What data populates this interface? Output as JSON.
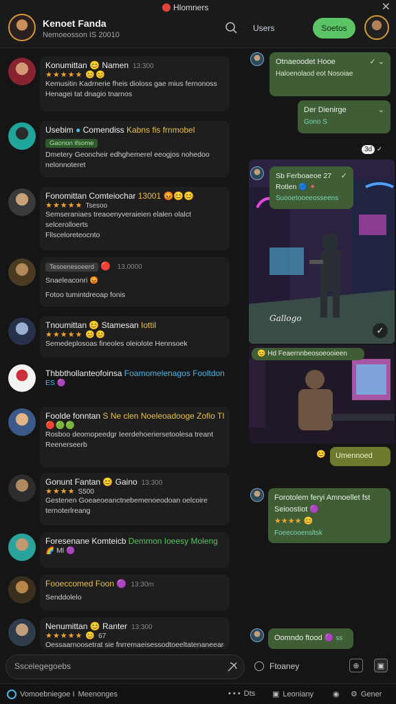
{
  "header": {
    "app_title": "Hlomners",
    "user_name": "Kenoet Fanda",
    "user_subtitle": "Nemoeosson IS 20010",
    "users_link": "Users",
    "green_button": "Soetos"
  },
  "conversations": [
    {
      "name": "Konumittan",
      "name_extra": "Namen",
      "time": "13:300",
      "stars": "★★★★★",
      "line1": "Kemusitin Kadrnerie fheis dioloss gae mius fernonoss",
      "line2": "Henagei tat dnagio tnarnos"
    },
    {
      "name": "Usebim",
      "name_extra": "Comendiss",
      "name_hl": "Kabns fis frnmobel",
      "tag": "Gaonon ifsome",
      "line1": "Dmetery Geoncheir edhghemerel eeogjos nohedoo",
      "line2": "nelonnoteret"
    },
    {
      "name": "Fonomittan",
      "name_extra": "Comteiochar",
      "time": "13001",
      "stars": "★★★★★",
      "stars_text": "Tsesoo",
      "line1": "Semseraniaes treaoenyveraieien elalen olalct",
      "line2": "selcerolloerts",
      "line3": "Fllsceloreteocnto"
    },
    {
      "name_pill": "Tesoenesoeerd",
      "time": "13,0000",
      "line1": "Snaeleaconri",
      "line2": "Fotoo tumintdreoap fonis"
    },
    {
      "name": "Tnoumittan",
      "name_extra": "Stamesan",
      "name_hl": "Iottil",
      "stars": "★★★★★",
      "line1": "Semedeplosoas fineoles oleiolote Hennsoek"
    },
    {
      "name": "Thbbthollanteofoinsa",
      "name_hl": "Foamomelenagos Fooltdon",
      "line1": "ES"
    },
    {
      "name": "Foolde fonntan",
      "name_hl": "S Ne clen Noeleoadooge Zofio TI",
      "line1": "Rosboo deomopeedgr Ieerdehoeriersetoolesa treant",
      "line2": "Reenerseerb"
    },
    {
      "name": "Gonunt Fantan",
      "name_extra": "Gaino",
      "time": "13:300",
      "stars": "★★★★",
      "stars_text": "S500",
      "line1": "Gestenen Goeaeoeanctnebemenoeodoan oelcoire",
      "line2": "ternoterlreang"
    },
    {
      "name": "Foresenane",
      "name_extra": "Komteicb",
      "name_hl": "Demmon Ioeesy Moleng",
      "line1": "Ml"
    },
    {
      "name": "Fooeccomed",
      "name_extra": "Foon",
      "time": "13:30m",
      "line1": "Senddolelo"
    },
    {
      "name": "Nenumittan",
      "name_extra": "Ranter",
      "time": "13:300",
      "stars": "★★★★★",
      "stars_text": "67",
      "line1": "Oessaarnoosetrat sie fnrremaeisessodtoeeltatenaneeare"
    }
  ],
  "chat": {
    "msg1": "Otnaeoodet Hooe",
    "msg1_sub": "Haloenolaod eot Nosoiae",
    "msg2": "Der Dienirge",
    "msg2_sub": "Gono S",
    "msg3_time": "3d",
    "msg4": "Sb Ferboaeoe 27",
    "msg4_b": "Rotlen",
    "msg4_sub": "Suooetooeeosseens",
    "img1_caption": "Gallogo",
    "img2_label": "Hd Feaernnbeosoeooieen",
    "msg5": "Umennoed",
    "msg6": "Forotolem feryi Amnoellet fst",
    "msg6_b": "Seioostiot",
    "msg6_stars": "★★★★",
    "msg6_sub": "Foeecooensltsk",
    "msg7": "Oomndo ftood"
  },
  "composer": {
    "placeholder": "Sscelegegoebs",
    "right_label": "Ftoaney"
  },
  "bottom_bar": {
    "left": "Vomoebniegoe I",
    "left2": "Meenonges",
    "dots_label": "Dts",
    "item2": "Leoniany",
    "item3": "Gener"
  },
  "colors": {
    "accent_green": "#5bc466",
    "bubble_green": "#3f5e35",
    "star_orange": "#f2a62d",
    "highlight_yellow": "#e8c14b"
  }
}
